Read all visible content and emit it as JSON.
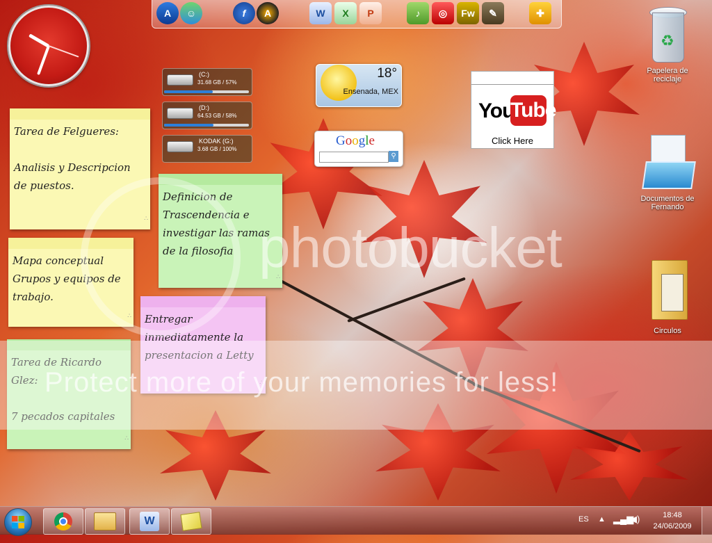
{
  "desktop": {
    "wallpaper": "autumn red maple leaves"
  },
  "dock": {
    "icons": [
      "aim-icon",
      "messenger-icon",
      "firefox-icon",
      "aimp-icon",
      "word-icon",
      "excel-icon",
      "powerpoint-icon",
      "dreamweaver-icon",
      "picture-icon",
      "fireworks-icon",
      "gimp-icon",
      "puzzle-icon"
    ],
    "fireworks_label": "Fw"
  },
  "drives": [
    {
      "name": "(C:)",
      "info": "31.68 GB / 57%",
      "used": 0.57
    },
    {
      "name": "(D:)",
      "info": "64.53 GB / 58%",
      "used": 0.58
    },
    {
      "name": "KODAK (G:)",
      "info": "3.68 GB / 100%",
      "used": 1.0
    }
  ],
  "weather": {
    "temperature": "18°",
    "city": "Ensenada, MEX"
  },
  "google": {
    "logo": "Google"
  },
  "youtube": {
    "you": "You",
    "tube": "Tube",
    "click": "Click Here"
  },
  "notes": {
    "felgueres": "Tarea de Felgueres:\n\nAnalisis y Descripcion de puestos.",
    "filosofia": "Definicion de Trascendencia e investigar las ramas de la filosofia",
    "mapa": "Mapa conceptual Grupos y equipos de trabajo.",
    "entregar": "Entregar inmediatamente la presentacion a Letty",
    "ricardo": "Tarea de Ricardo Glez:\n\n7 pecados capitales"
  },
  "desktop_icons": {
    "recycle": "Papelera de reciclaje",
    "documents": "Documentos de Fernando",
    "circulos": "Circulos"
  },
  "watermark": {
    "logo": "photobucket",
    "tagline": "Protect more of your memories for less!"
  },
  "taskbar": {
    "language": "ES",
    "time": "18:48",
    "date": "24/06/2009"
  }
}
